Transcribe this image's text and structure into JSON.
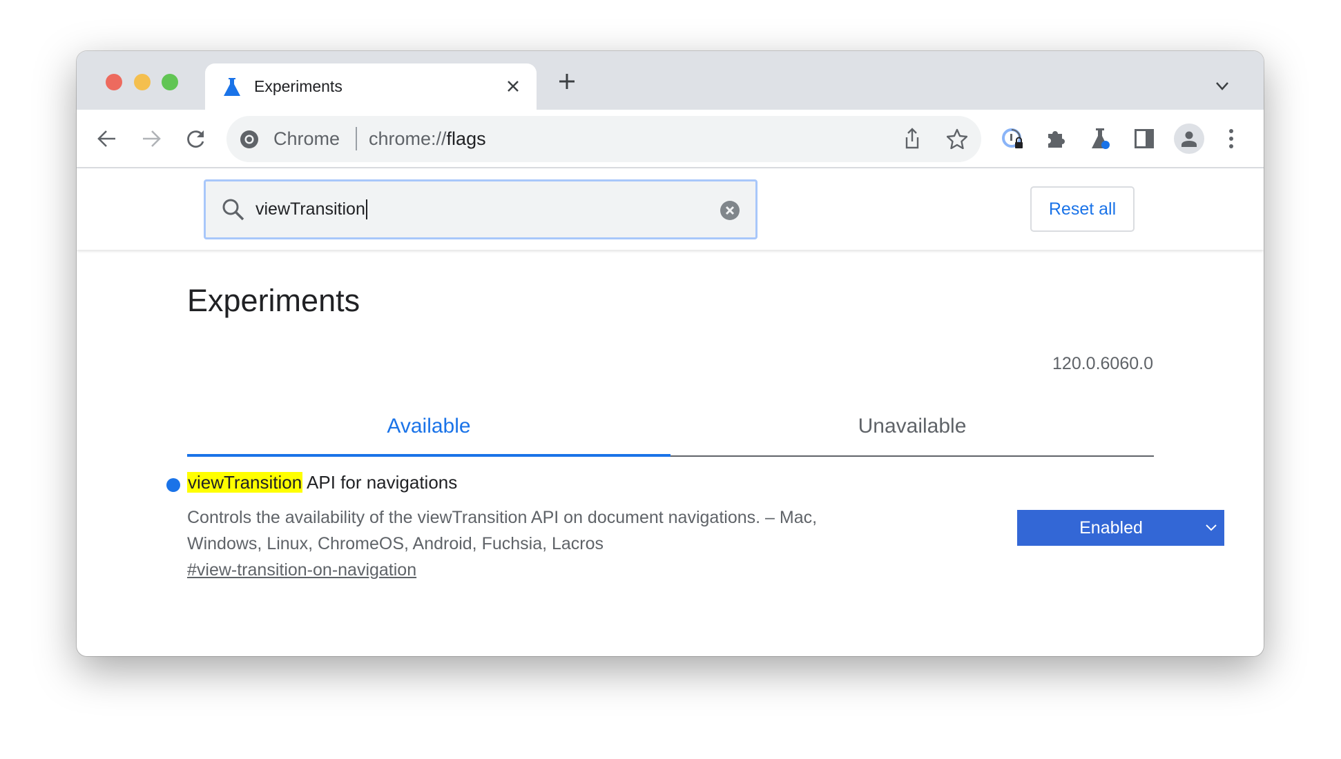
{
  "browser": {
    "tab_title": "Experiments",
    "omnibox_site_label": "Chrome",
    "omnibox_url_prefix": "chrome://",
    "omnibox_url_host": "flags",
    "colors": {
      "accent": "#1a73e8",
      "select_bg": "#3367d6",
      "highlight": "#ffff00"
    }
  },
  "search": {
    "value": "viewTransition",
    "clear_icon": "clear-circle-icon"
  },
  "header": {
    "reset_label": "Reset all"
  },
  "page": {
    "title": "Experiments",
    "version": "120.0.6060.0",
    "tabs": [
      {
        "label": "Available",
        "active": true
      },
      {
        "label": "Unavailable",
        "active": false
      }
    ]
  },
  "flags": [
    {
      "title_highlight": "viewTransition",
      "title_rest": " API for navigations",
      "description_line1": "Controls the availability of the viewTransition API on document navigations. – Mac,",
      "description_line2": "Windows, Linux, ChromeOS, Android, Fuchsia, Lacros",
      "link": "#view-transition-on-navigation",
      "state": "Enabled"
    }
  ]
}
